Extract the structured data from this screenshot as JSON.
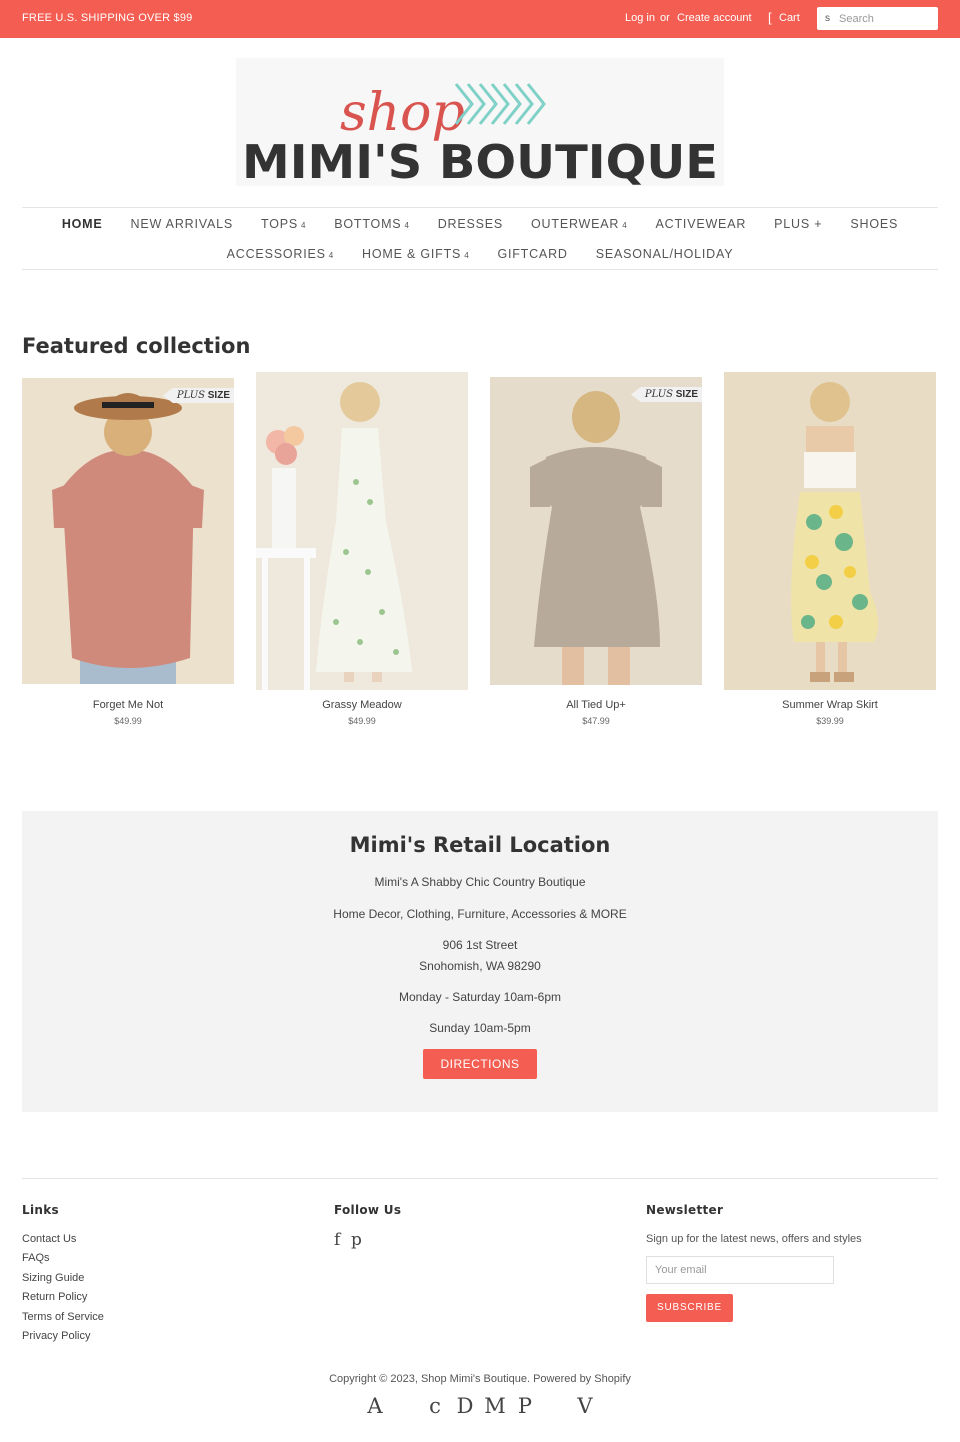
{
  "announcement": {
    "promo": "FREE U.S. SHIPPING OVER $99",
    "login": "Log in",
    "or": "or",
    "create_account": "Create account",
    "cart_icon": "[",
    "cart": "Cart",
    "search_icon": "s",
    "search_placeholder": "Search"
  },
  "brand": {
    "script": "shop",
    "name": "MIMI'S BOUTIQUE",
    "colors": {
      "script": "#d9534f",
      "arrows": "#7fd1c7",
      "name": "#333333"
    }
  },
  "nav": {
    "row1": [
      {
        "label": "HOME",
        "caret": ""
      },
      {
        "label": "NEW ARRIVALS",
        "caret": ""
      },
      {
        "label": "TOPS",
        "caret": "4"
      },
      {
        "label": "BOTTOMS",
        "caret": "4"
      },
      {
        "label": "DRESSES",
        "caret": ""
      },
      {
        "label": "OUTERWEAR",
        "caret": "4"
      },
      {
        "label": "ACTIVEWEAR",
        "caret": ""
      },
      {
        "label": "PLUS +",
        "caret": ""
      },
      {
        "label": "SHOES",
        "caret": ""
      }
    ],
    "row2": [
      {
        "label": "ACCESSORIES",
        "caret": "4"
      },
      {
        "label": "HOME & GIFTS",
        "caret": "4"
      },
      {
        "label": "GIFTCARD",
        "caret": ""
      },
      {
        "label": "SEASONAL/HOLIDAY",
        "caret": ""
      }
    ]
  },
  "featured": {
    "title": "Featured collection",
    "badge_italic": "PLUS",
    "badge_bold": "SIZE",
    "products": [
      {
        "name": "Forget Me Not",
        "price": "$49.99",
        "plus": true
      },
      {
        "name": "Grassy Meadow",
        "price": "$49.99",
        "plus": false
      },
      {
        "name": "All Tied Up+",
        "price": "$47.99",
        "plus": true
      },
      {
        "name": "Summer Wrap Skirt",
        "price": "$39.99",
        "plus": false
      }
    ]
  },
  "retail": {
    "title": "Mimi's Retail Location",
    "line1": "Mimi's A Shabby Chic Country Boutique",
    "line2": "Home Decor, Clothing, Furniture, Accessories & MORE",
    "street": "906 1st Street",
    "city": "Snohomish, WA 98290",
    "hours1": "Monday - Saturday 10am-6pm",
    "hours2": "Sunday 10am-5pm",
    "button_icon": "",
    "button": "DIRECTIONS"
  },
  "footer": {
    "links_heading": "Links",
    "links": [
      "Contact Us",
      "FAQs",
      "Sizing Guide",
      "Return Policy",
      "Terms of Service",
      "Privacy Policy"
    ],
    "follow_heading": "Follow Us",
    "social": [
      "f",
      "p",
      ""
    ],
    "newsletter_heading": "Newsletter",
    "newsletter_text": "Sign up for the latest news, offers and styles",
    "email_placeholder": "Your email",
    "subscribe": "SUBSCRIBE",
    "copyright": "Copyright © 2023, Shop Mimi's Boutique. Powered by Shopify",
    "payment_icons": [
      "A",
      "",
      "c",
      "D",
      "M",
      "P",
      "",
      "V"
    ]
  },
  "colors": {
    "accent": "#f45d52",
    "panel": "#f3f3f3"
  }
}
